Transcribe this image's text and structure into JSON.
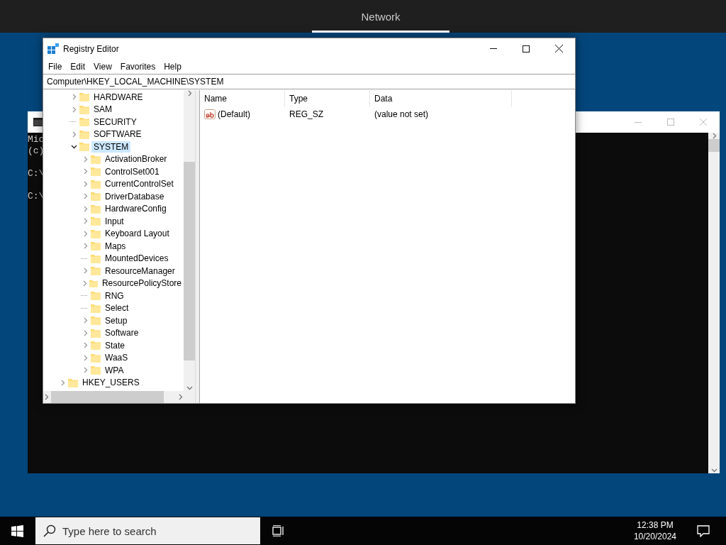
{
  "top_bar": {
    "tab": {
      "label": "Network",
      "selected": true
    }
  },
  "console_window": {
    "lines": [
      {
        "text": "Mic",
        "blank_before": false
      },
      {
        "text": "(c)",
        "blank_before": false
      },
      {
        "text": "C:\\",
        "blank_before": true
      },
      {
        "text": "C:\\",
        "blank_before": true
      }
    ]
  },
  "registry_window": {
    "title": "Registry Editor",
    "menu": [
      "File",
      "Edit",
      "View",
      "Favorites",
      "Help"
    ],
    "address": "Computer\\HKEY_LOCAL_MACHINE\\SYSTEM",
    "tree": {
      "items": [
        {
          "label": "HARDWARE",
          "expandable": true,
          "expanded": false,
          "selected": false
        },
        {
          "label": "SAM",
          "expandable": true,
          "expanded": false,
          "selected": false
        },
        {
          "label": "SECURITY",
          "expandable": false,
          "selected": false
        },
        {
          "label": "SOFTWARE",
          "expandable": true,
          "expanded": false,
          "selected": false
        },
        {
          "label": "SYSTEM",
          "expandable": true,
          "expanded": true,
          "selected": true,
          "children": [
            {
              "label": "ActivationBroker",
              "expandable": true,
              "expanded": false,
              "selected": false
            },
            {
              "label": "ControlSet001",
              "expandable": true,
              "expanded": false,
              "selected": false
            },
            {
              "label": "CurrentControlSet",
              "expandable": true,
              "expanded": false,
              "selected": false
            },
            {
              "label": "DriverDatabase",
              "expandable": true,
              "expanded": false,
              "selected": false
            },
            {
              "label": "HardwareConfig",
              "expandable": true,
              "expanded": false,
              "selected": false
            },
            {
              "label": "Input",
              "expandable": true,
              "expanded": false,
              "selected": false
            },
            {
              "label": "Keyboard Layout",
              "expandable": true,
              "expanded": false,
              "selected": false
            },
            {
              "label": "Maps",
              "expandable": true,
              "expanded": false,
              "selected": false
            },
            {
              "label": "MountedDevices",
              "expandable": false,
              "selected": false
            },
            {
              "label": "ResourceManager",
              "expandable": true,
              "expanded": false,
              "selected": false
            },
            {
              "label": "ResourcePolicyStore",
              "expandable": true,
              "expanded": false,
              "selected": false
            },
            {
              "label": "RNG",
              "expandable": false,
              "selected": false
            },
            {
              "label": "Select",
              "expandable": false,
              "selected": false
            },
            {
              "label": "Setup",
              "expandable": true,
              "expanded": false,
              "selected": false
            },
            {
              "label": "Software",
              "expandable": true,
              "expanded": false,
              "selected": false
            },
            {
              "label": "State",
              "expandable": true,
              "expanded": false,
              "selected": false
            },
            {
              "label": "WaaS",
              "expandable": true,
              "expanded": false,
              "selected": false
            },
            {
              "label": "WPA",
              "expandable": true,
              "expanded": false,
              "selected": false
            }
          ]
        }
      ],
      "next_root": {
        "label": "HKEY_USERS",
        "expandable": true,
        "expanded": false,
        "selected": false
      }
    },
    "values": {
      "columns": [
        "Name",
        "Type",
        "Data"
      ],
      "rows": [
        {
          "name": "(Default)",
          "type": "REG_SZ",
          "data": "(value not set)"
        }
      ]
    }
  },
  "taskbar": {
    "search": {
      "placeholder": "Type here to search"
    },
    "time": "12:38 PM",
    "date": "10/20/2024"
  }
}
